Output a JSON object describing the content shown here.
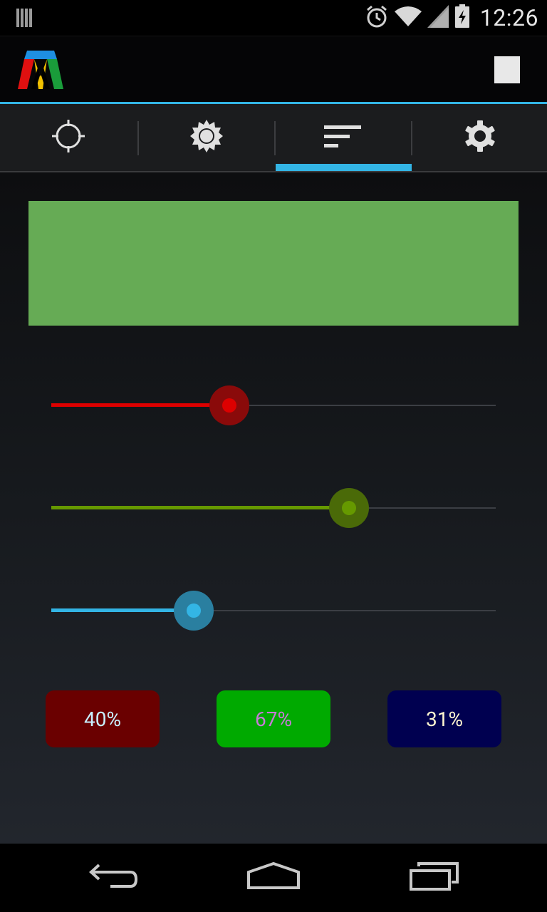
{
  "status_bar": {
    "time": "12:26",
    "icons": [
      "notification-icon",
      "alarm-icon",
      "wifi-icon",
      "signal-icon",
      "battery-charging-icon"
    ]
  },
  "action_bar": {
    "logo": "app-logo",
    "action_icon": "stop-icon"
  },
  "tabs": [
    {
      "icon": "crosshair-icon",
      "selected": false
    },
    {
      "icon": "brightness-icon",
      "selected": false
    },
    {
      "icon": "sort-lines-icon",
      "selected": true
    },
    {
      "icon": "settings-gear-icon",
      "selected": false
    }
  ],
  "preview": {
    "color": "#66ab55"
  },
  "sliders": [
    {
      "channel": "red",
      "value": 0.4,
      "color": "#dd0000",
      "halo": "#8a0a0a"
    },
    {
      "channel": "green",
      "value": 0.67,
      "color": "#669900",
      "halo": "#4a6a08"
    },
    {
      "channel": "blue",
      "value": 0.32,
      "color": "#33b5e5",
      "halo": "#2a7fa0"
    }
  ],
  "values": [
    {
      "label": "40%",
      "bg": "#6a0000",
      "fg": "#c8f0ff"
    },
    {
      "label": "67%",
      "bg": "#00aa00",
      "fg": "#c87ad8"
    },
    {
      "label": "31%",
      "bg": "#000050",
      "fg": "#fff6d0"
    }
  ],
  "nav": {
    "icons": [
      "back-icon",
      "home-icon",
      "recent-apps-icon"
    ]
  },
  "colors": {
    "accent": "#33b5e5",
    "action_bar": "#050506",
    "tab_bar": "#1b1c1e"
  }
}
